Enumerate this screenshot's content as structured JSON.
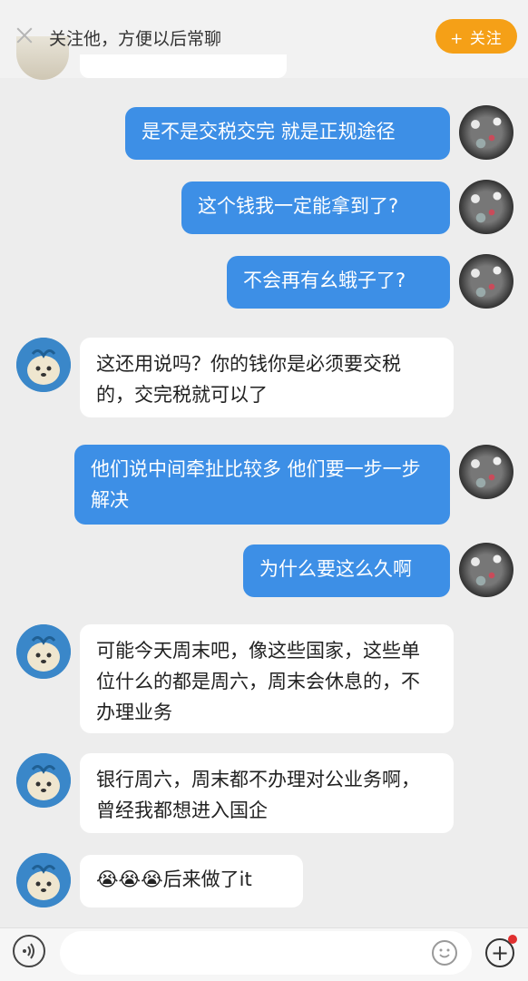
{
  "header": {
    "follow_hint": "关注他，方便以后常聊",
    "follow_button": "+ 关注",
    "close_icon": "close-icon"
  },
  "colors": {
    "outgoing_bubble": "#3d8fe6",
    "incoming_bubble": "#ffffff",
    "follow_button": "#f5a017",
    "background": "#ededed"
  },
  "messages": [
    {
      "sender": "self",
      "text": "是不是交税交完 就是正规途径"
    },
    {
      "sender": "self",
      "text": "这个钱我一定能拿到了?"
    },
    {
      "sender": "self",
      "text": "不会再有幺蛾子了?"
    },
    {
      "sender": "peer",
      "text": "这还用说吗？你的钱你是必须要交税的，交完税就可以了"
    },
    {
      "sender": "self",
      "text": "他们说中间牵扯比较多 他们要一步一步解决"
    },
    {
      "sender": "self",
      "text": "为什么要这么久啊"
    },
    {
      "sender": "peer",
      "text": "可能今天周末吧，像这些国家，这些单位什么的都是周六，周末会休息的，不办理业务"
    },
    {
      "sender": "peer",
      "text": "银行周六，周末都不办理对公业务啊，曾经我都想进入国企"
    },
    {
      "sender": "peer",
      "text": "😭😭😭后来做了it"
    }
  ],
  "input_bar": {
    "voice_icon": "voice-icon",
    "emoji_icon": "emoji-icon",
    "plus_icon": "plus-icon",
    "plus_symbol": "+",
    "placeholder": ""
  }
}
